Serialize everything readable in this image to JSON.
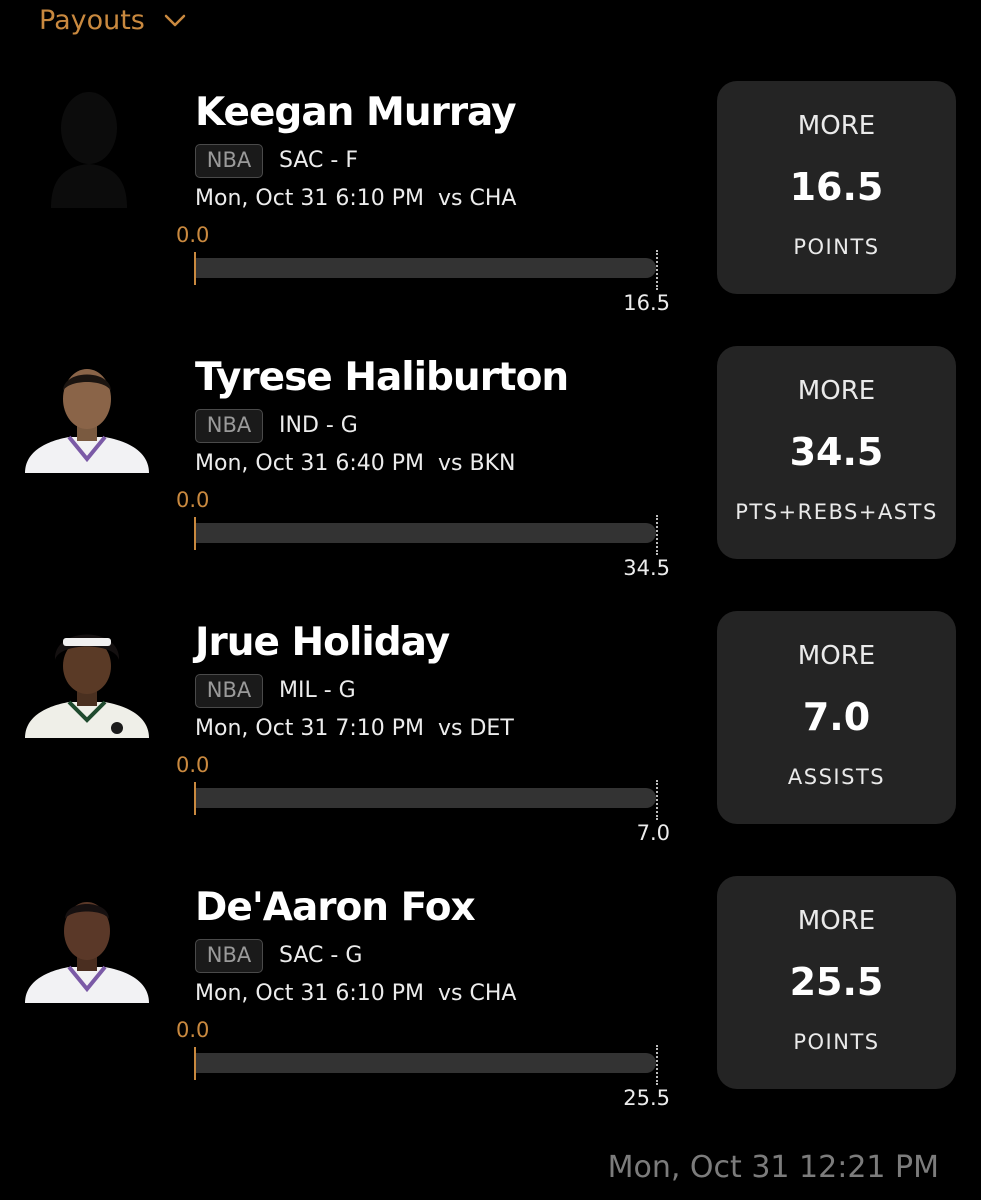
{
  "header": {
    "title": "Payouts",
    "dropdown_icon": "chevron-down-icon",
    "accent_color": "#c9893f"
  },
  "picks": [
    {
      "player": "Keegan Murray",
      "league": "NBA",
      "team_pos": "SAC - F",
      "game": "Mon, Oct 31 6:10 PM  vs CHA",
      "current": "0.0",
      "line": "16.5",
      "direction": "MORE",
      "stat": "POINTS",
      "avatar": "placeholder-silhouette",
      "jersey_color": ""
    },
    {
      "player": "Tyrese Haliburton",
      "league": "NBA",
      "team_pos": "IND - G",
      "game": "Mon, Oct 31 6:40 PM  vs BKN",
      "current": "0.0",
      "line": "34.5",
      "direction": "MORE",
      "stat": "PTS+REBS+ASTS",
      "avatar": "player-headshot",
      "jersey_color": "#f2f2f4"
    },
    {
      "player": "Jrue Holiday",
      "league": "NBA",
      "team_pos": "MIL - G",
      "game": "Mon, Oct 31 7:10 PM  vs DET",
      "current": "0.0",
      "line": "7.0",
      "direction": "MORE",
      "stat": "ASSISTS",
      "avatar": "player-headshot",
      "jersey_color": "#efefe8"
    },
    {
      "player": "De'Aaron Fox",
      "league": "NBA",
      "team_pos": "SAC - G",
      "game": "Mon, Oct 31 6:10 PM  vs CHA",
      "current": "0.0",
      "line": "25.5",
      "direction": "MORE",
      "stat": "POINTS",
      "avatar": "player-headshot",
      "jersey_color": "#f2f2f4"
    }
  ],
  "timestamp": "Mon, Oct 31 12:21 PM"
}
